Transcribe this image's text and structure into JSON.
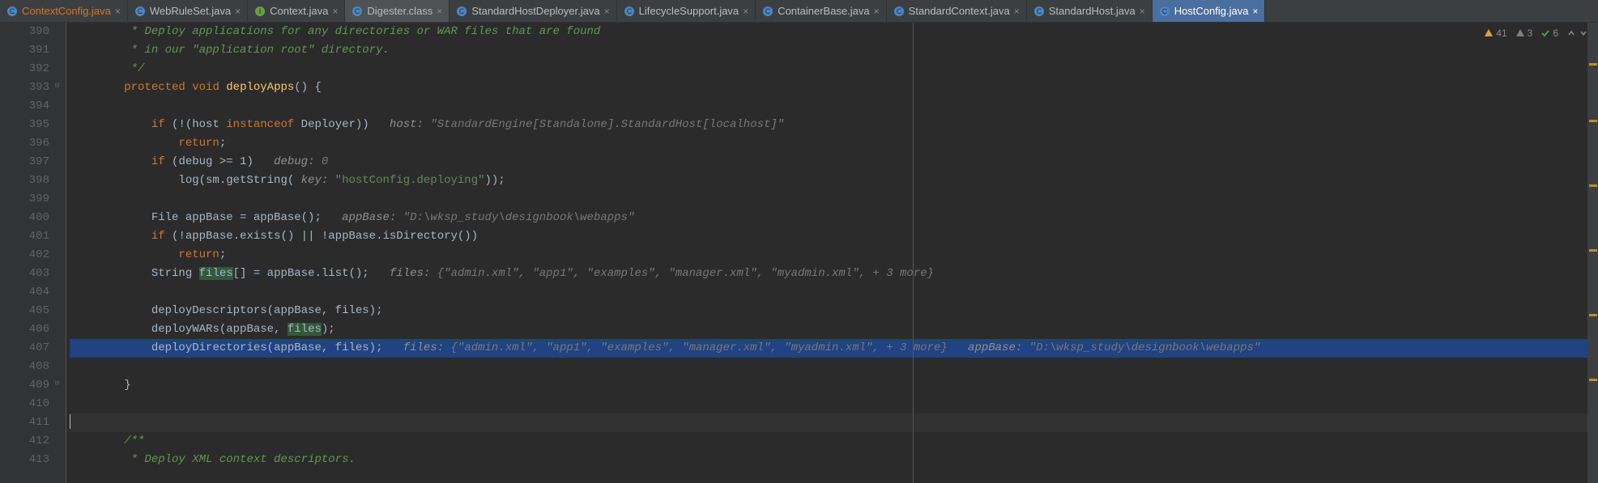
{
  "tabs": [
    {
      "label": "ContextConfig.java",
      "modified": true,
      "active": false,
      "highlighted": false
    },
    {
      "label": "WebRuleSet.java",
      "modified": false,
      "active": false,
      "highlighted": false
    },
    {
      "label": "Context.java",
      "modified": false,
      "active": false,
      "highlighted": false
    },
    {
      "label": "Digester.class",
      "modified": false,
      "active": true,
      "highlighted": false
    },
    {
      "label": "StandardHostDeployer.java",
      "modified": false,
      "active": false,
      "highlighted": false
    },
    {
      "label": "LifecycleSupport.java",
      "modified": false,
      "active": false,
      "highlighted": false
    },
    {
      "label": "ContainerBase.java",
      "modified": false,
      "active": false,
      "highlighted": false
    },
    {
      "label": "StandardContext.java",
      "modified": false,
      "active": false,
      "highlighted": false
    },
    {
      "label": "StandardHost.java",
      "modified": false,
      "active": false,
      "highlighted": false
    },
    {
      "label": "HostConfig.java",
      "modified": false,
      "active": false,
      "highlighted": true
    }
  ],
  "inspection": {
    "errors": "41",
    "warnings": "3",
    "typos": "6"
  },
  "gutter": [
    "390",
    "391",
    "392",
    "393",
    "394",
    "395",
    "396",
    "397",
    "398",
    "399",
    "400",
    "401",
    "402",
    "403",
    "404",
    "405",
    "406",
    "407",
    "408",
    "409",
    "410",
    "411",
    "412",
    "413"
  ],
  "code": {
    "l390": {
      "comment": " * Deploy applications for any directories or WAR files that are found"
    },
    "l391": {
      "comment": " * in our \"application root\" directory."
    },
    "l392": {
      "comment": " */"
    },
    "l393": {
      "kw1": "protected",
      "kw2": "void",
      "fn": "deployApps",
      "tail": "() {"
    },
    "l395": {
      "kw1": "if",
      "p1": " (!(host ",
      "kw2": "instanceof",
      "p2": " Deployer))",
      "hint_label": "host:",
      "hint": " \"StandardEngine[Standalone].StandardHost[localhost]\""
    },
    "l396": {
      "kw": "return",
      "tail": ";"
    },
    "l397": {
      "kw": "if",
      "cond": " (debug >= 1)",
      "hint_label": "debug:",
      "hint": " 0"
    },
    "l398": {
      "p1": "log(sm.getString(",
      "hint_label": " key:",
      "str": " \"hostConfig.deploying\"",
      "tail": "));"
    },
    "l400": {
      "p1": "File appBase = appBase();",
      "hint_label": "appBase:",
      "hint": " \"D:\\wksp_study\\designbook\\webapps\""
    },
    "l401": {
      "kw": "if",
      "cond": " (!appBase.exists() || !appBase.isDirectory())"
    },
    "l402": {
      "kw": "return",
      "tail": ";"
    },
    "l403": {
      "p1": "String ",
      "hl": "files",
      "p2": "[] = appBase.list();",
      "hint_label": "files:",
      "hint": " {\"admin.xml\", \"app1\", \"examples\", \"manager.xml\", \"myadmin.xml\", + 3 more}"
    },
    "l405": {
      "text": "deployDescriptors(appBase, files);"
    },
    "l406": {
      "p1": "deployWARs(appBase, ",
      "hl": "files",
      "p2": ");"
    },
    "l407": {
      "p1": "deployDirectories(appBase, files);",
      "hint1_label": "files:",
      "hint1": " {\"admin.xml\", \"app1\", \"examples\", \"manager.xml\", \"myadmin.xml\", + 3 more}",
      "hint2_label": "appBase:",
      "hint2": " \"D:\\wksp_study\\designbook\\webapps\""
    },
    "l409": {
      "text": "}"
    },
    "l412": {
      "comment": "/**"
    },
    "l413": {
      "comment": " * Deploy XML context descriptors."
    }
  }
}
